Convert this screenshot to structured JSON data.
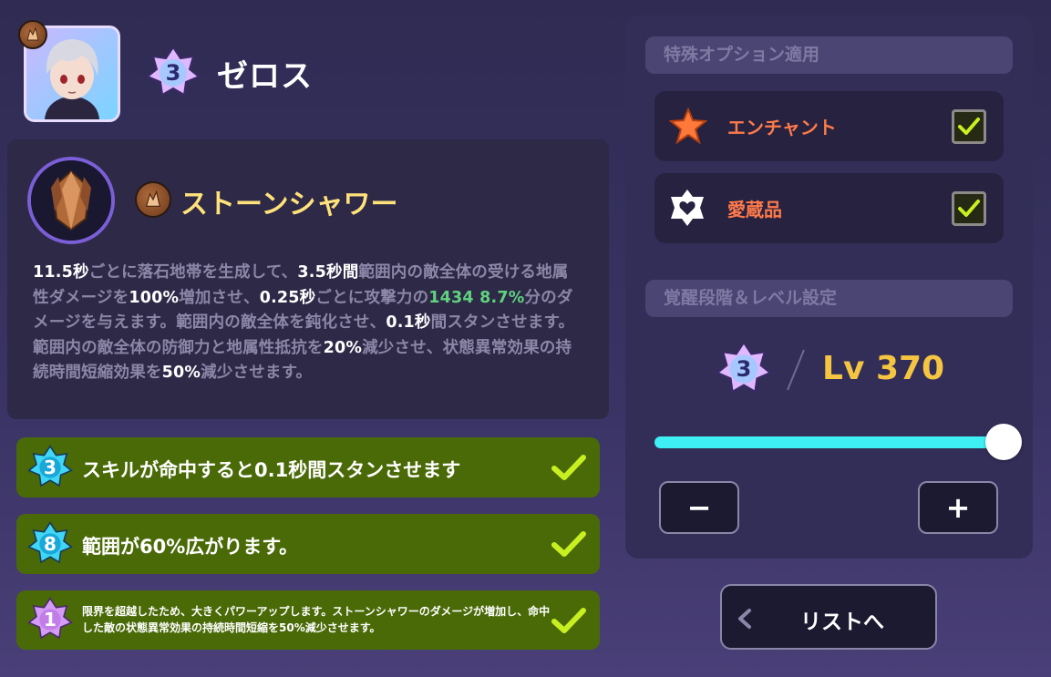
{
  "header": {
    "character_name": "ゼロス",
    "rank": "3",
    "element_icon": "earth-element-icon"
  },
  "skill": {
    "name": "ストーンシャワー",
    "icon": "stone-crystal-icon",
    "desc": [
      {
        "t": "11.5秒",
        "c": "w"
      },
      {
        "t": "ごとに落石地帯を生成して、",
        "c": "d"
      },
      {
        "t": "3.5秒間",
        "c": "w"
      },
      {
        "t": "範囲内の敵全体の受ける地属性ダメージを",
        "c": "d"
      },
      {
        "t": "100%",
        "c": "w"
      },
      {
        "t": "増加させ、",
        "c": "d"
      },
      {
        "t": "0.25秒",
        "c": "w"
      },
      {
        "t": "ごとに攻撃力の",
        "c": "d"
      },
      {
        "t": "1434 8.7%",
        "c": "g"
      },
      {
        "t": "分のダメージを与えます。範囲内の敵全体を鈍化させ、",
        "c": "d"
      },
      {
        "t": "0.1秒",
        "c": "w"
      },
      {
        "t": "間スタンさせます。範囲内の敵全体の防御力と地属性抵抗を",
        "c": "d"
      },
      {
        "t": "20%",
        "c": "w"
      },
      {
        "t": "減少させ、状態異常効果の持続時間短縮効果を",
        "c": "d"
      },
      {
        "t": "50%",
        "c": "w"
      },
      {
        "t": "減少させます。",
        "c": "d"
      }
    ]
  },
  "passives": [
    {
      "rank": "3",
      "text": "スキルが命中すると0.1秒間スタンさせます",
      "checked": true,
      "star_color": "#3fd7f5"
    },
    {
      "rank": "8",
      "text": "範囲が60%広がります。",
      "checked": true,
      "star_color": "#3fd7f5"
    },
    {
      "rank": "1",
      "text": "限界を超越したため、大きくパワーアップします。ストーンシャワーのダメージが増加し、命中した敵の状態異常効果の持続時間短縮を50%減少させます。",
      "checked": true,
      "star_color": "#d49cf5"
    }
  ],
  "special_options": {
    "heading": "特殊オプション適用",
    "items": [
      {
        "label": "エンチャント",
        "icon": "enchant-star-icon",
        "checked": true
      },
      {
        "label": "愛蔵品",
        "icon": "treasure-heart-icon",
        "checked": true
      }
    ]
  },
  "awakening": {
    "heading": "覚醒段階＆レベル設定",
    "rank": "3",
    "level_text": "Lv 370",
    "slider_fraction": 1.0
  },
  "buttons": {
    "minus": "−",
    "plus": "+",
    "list_back": "リストへ"
  },
  "colors": {
    "background": "#2f2b52",
    "accent_cyan": "#3ef0f4",
    "skill_name": "#ffe27a",
    "level": "#f5c542",
    "option_label": "#ff7a4a",
    "passive_bg": "#4a6a08",
    "check": "#c8f020"
  }
}
